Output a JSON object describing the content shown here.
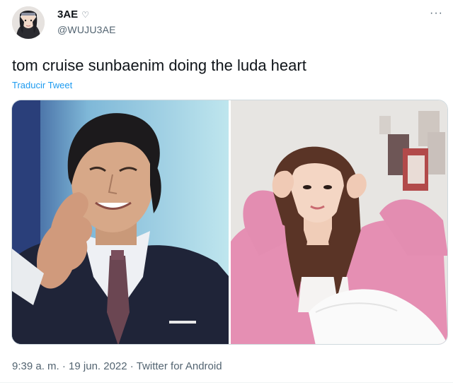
{
  "author": {
    "display_name": "3AE",
    "name_icon": "heart-outline-icon",
    "handle": "@WUJU3AE"
  },
  "header": {
    "more_label": "···"
  },
  "tweet": {
    "text": "tom cruise sunbaenim doing the luda heart",
    "translate_label": "Traducir Tweet"
  },
  "media": {
    "images": [
      "photo-left",
      "photo-right"
    ]
  },
  "meta": {
    "time": "9:39 a. m.",
    "date": "19 jun. 2022",
    "source": "Twitter for Android",
    "separator": " · "
  },
  "colors": {
    "text": "#0f1419",
    "secondary": "#536471",
    "link": "#1d9bf0",
    "border": "#cfd9de"
  }
}
